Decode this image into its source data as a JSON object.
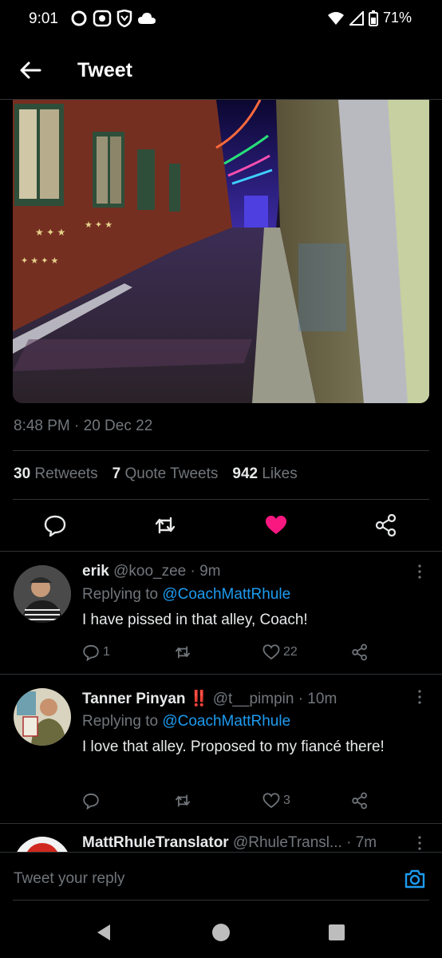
{
  "status_bar": {
    "time": "9:01",
    "battery": "71%"
  },
  "header": {
    "title": "Tweet"
  },
  "tweet": {
    "timestamp": "8:48 PM · 20 Dec 22",
    "retweets_count": "30",
    "retweets_label": "Retweets",
    "quotes_count": "7",
    "quotes_label": "Quote Tweets",
    "likes_count": "942",
    "likes_label": "Likes",
    "liked_color": "#f91880"
  },
  "replies": [
    {
      "name": "erik",
      "handle": "@koo_zee · 9m",
      "replying_prefix": "Replying to",
      "replying_to": "@CoachMattRhule",
      "text": "I have pissed in that alley, Coach!",
      "reply_count": "1",
      "retweet_count": "",
      "like_count": "22"
    },
    {
      "name": "Tanner Pinyan",
      "emoji": "‼️",
      "handle": "@t__pimpin · 10m",
      "replying_prefix": "Replying to",
      "replying_to": "@CoachMattRhule",
      "text": "I love that alley. Proposed to my fiancé there!",
      "reply_count": "",
      "retweet_count": "",
      "like_count": "3"
    },
    {
      "name": "MattRhuleTranslator",
      "handle": "@RhuleTransl... · 7m"
    }
  ],
  "composer": {
    "placeholder": "Tweet your reply"
  },
  "icons": {
    "back": "arrow-left-icon",
    "reply": "comment-icon",
    "retweet": "retweet-icon",
    "like": "heart-icon",
    "share": "share-icon",
    "more": "more-vertical-icon",
    "camera": "camera-icon"
  },
  "colors": {
    "accent": "#1d9bf0",
    "muted": "#71767b",
    "background": "#000000"
  }
}
